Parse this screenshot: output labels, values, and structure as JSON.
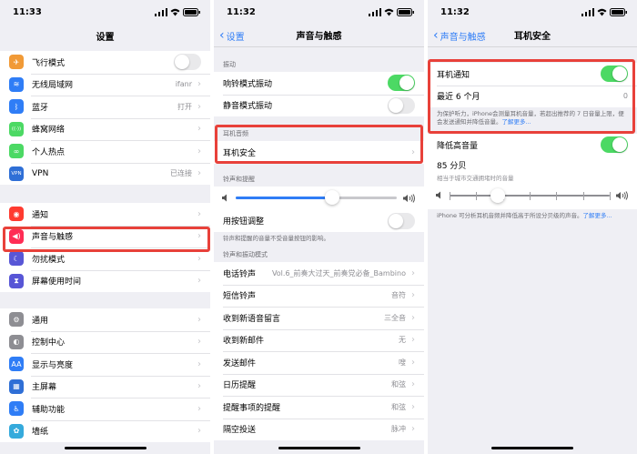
{
  "panel1": {
    "time": "11:33",
    "title": "设置",
    "group1": [
      {
        "icon": "airplane-icon",
        "glyph": "✈",
        "color": "#f19a37",
        "label": "飞行模式",
        "type": "toggle",
        "on": false
      },
      {
        "icon": "wifi-icon",
        "glyph": "≋",
        "color": "#2f7df6",
        "label": "无线局域网",
        "value": "ifanr"
      },
      {
        "icon": "bluetooth-icon",
        "glyph": "ᛒ",
        "color": "#2f7df6",
        "label": "蓝牙",
        "value": "打开"
      },
      {
        "icon": "cellular-icon",
        "glyph": "((·))",
        "color": "#4cd964",
        "label": "蜂窝网络"
      },
      {
        "icon": "hotspot-icon",
        "glyph": "∞",
        "color": "#4cd964",
        "label": "个人热点"
      },
      {
        "icon": "vpn-icon",
        "glyph": "VPN",
        "color": "#2f6fd6",
        "label": "VPN",
        "value": "已连接"
      }
    ],
    "group2": [
      {
        "icon": "notifications-icon",
        "glyph": "◉",
        "color": "#ff3b30",
        "label": "通知"
      },
      {
        "icon": "sounds-icon",
        "glyph": "◀)",
        "color": "#ff2d55",
        "label": "声音与触感"
      },
      {
        "icon": "moon-icon",
        "glyph": "☾",
        "color": "#5856d6",
        "label": "勿扰模式"
      },
      {
        "icon": "hourglass-icon",
        "glyph": "⧗",
        "color": "#5856d6",
        "label": "屏幕使用时间"
      }
    ],
    "group3": [
      {
        "icon": "gear-icon",
        "glyph": "⚙",
        "color": "#8e8e93",
        "label": "通用"
      },
      {
        "icon": "control-center-icon",
        "glyph": "◐",
        "color": "#8e8e93",
        "label": "控制中心"
      },
      {
        "icon": "display-icon",
        "glyph": "AA",
        "color": "#2f7df6",
        "label": "显示与亮度"
      },
      {
        "icon": "home-screen-icon",
        "glyph": "▦",
        "color": "#2f6fd6",
        "label": "主屏幕"
      },
      {
        "icon": "accessibility-icon",
        "glyph": "♿",
        "color": "#2f7df6",
        "label": "辅助功能"
      },
      {
        "icon": "wallpaper-icon",
        "glyph": "✿",
        "color": "#35aadc",
        "label": "墙纸"
      }
    ]
  },
  "panel2": {
    "time": "11:32",
    "back": "设置",
    "title": "声音与触感",
    "vibrate_header": "振动",
    "vibrate": [
      {
        "label": "响铃模式振动",
        "on": true
      },
      {
        "label": "静音模式振动",
        "on": false
      }
    ],
    "headphone_header": "耳机音频",
    "headphone_safety": "耳机安全",
    "ringer_header": "铃声和提醒",
    "ringer_level": 0.6,
    "button_adjust": "用按钮调整",
    "button_adjust_on": false,
    "ringer_footer": "铃声和提醒的音量不受音量按钮的影响。",
    "patterns_header": "铃声和振动模式",
    "patterns": [
      {
        "label": "电话铃声",
        "value": "Vol.6_前奏大过天_前奏党必备_Bambino"
      },
      {
        "label": "短信铃声",
        "value": "音符"
      },
      {
        "label": "收到新语音留言",
        "value": "三全音"
      },
      {
        "label": "收到新邮件",
        "value": "无"
      },
      {
        "label": "发送邮件",
        "value": "嗖"
      },
      {
        "label": "日历提醒",
        "value": "和弦"
      },
      {
        "label": "提醒事项的提醒",
        "value": "和弦"
      },
      {
        "label": "隔空投送",
        "value": "脉冲"
      }
    ]
  },
  "panel3": {
    "time": "11:32",
    "back": "声音与触感",
    "title": "耳机安全",
    "notif_label": "耳机通知",
    "notif_on": true,
    "recent_label": "最近 6 个月",
    "recent_value": "0",
    "notif_footer_text": "为保护听力，iPhone会测量耳机音量，若超出推荐的 7 日音量上限，便会发送通知并降低音量。",
    "notif_footer_link": "了解更多...",
    "reduce_label": "降低高音量",
    "reduce_on": true,
    "db_value": "85 分贝",
    "db_sub": "相当于城市交通拥堵时的音量",
    "db_level": 0.3,
    "reduce_footer_text": "iPhone 可分析耳机音频并降低高于所设分贝级的声音。",
    "reduce_footer_link": "了解更多..."
  }
}
